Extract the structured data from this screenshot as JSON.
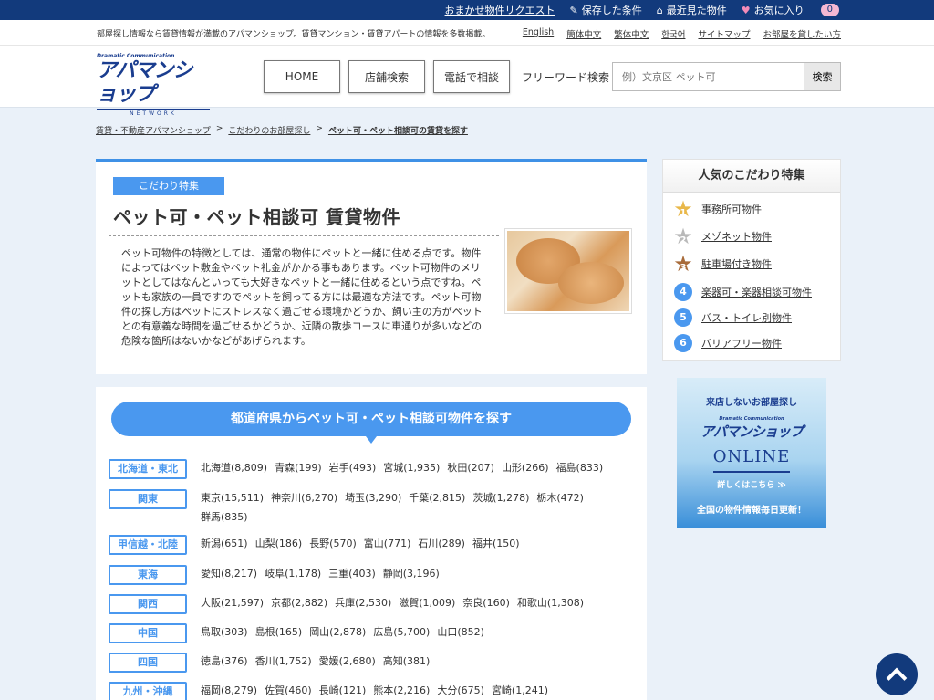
{
  "topbar": {
    "request": "おまかせ物件リクエスト",
    "saved": "保存した条件",
    "recent": "最近見た物件",
    "favorites": "お気に入り",
    "fav_count": "0"
  },
  "header": {
    "tagline": "部屋探し情報なら賃貸情報が満載のアパマンショップ。賃貸マンション・賃貸アパートの情報を多数掲載。",
    "langs": [
      "English",
      "簡体中文",
      "繁体中文",
      "한국어",
      "サイトマップ",
      "お部屋を貸したい方"
    ],
    "logo_small": "Dramatic Communication",
    "logo_main": "アパマンショップ",
    "logo_net": "NETWORK",
    "nav": [
      "HOME",
      "店舗検索",
      "電話で相談"
    ],
    "freeword_label": "フリーワード検索",
    "search_placeholder": "例）文京区 ペット可",
    "search_button": "検索"
  },
  "breadcrumb": [
    "賃貸・不動産アパマンショップ",
    "こだわりのお部屋探し",
    "ペット可・ペット相談可の賃貸を探す"
  ],
  "intro": {
    "tag": "こだわり特集",
    "title": "ペット可・ペット相談可 賃貸物件",
    "text": "ペット可物件の特徴としては、通常の物件にペットと一緒に住める点です。物件によってはペット敷金やペット礼金がかかる事もあります。ペット可物件のメリットとしてはなんといっても大好きなペットと一緒に住めるという点ですね。ペットも家族の一員ですのでペットを飼ってる方には最適な方法です。ペット可物件の探し方はペットにストレスなく過ごせる環境かどうか、飼い主の方がペットとの有意義な時間を過ごせるかどうか、近隣の散歩コースに車通りが多いなどの危険な箇所はないかなどがあげられます。"
  },
  "pref": {
    "heading": "都道府県からペット可・ペット相談可物件を探す",
    "regions": [
      {
        "name": "北海道・東北",
        "items": [
          "北海道(8,809)",
          "青森(199)",
          "岩手(493)",
          "宮城(1,935)",
          "秋田(207)",
          "山形(266)",
          "福島(833)"
        ]
      },
      {
        "name": "関東",
        "items": [
          "東京(15,511)",
          "神奈川(6,270)",
          "埼玉(3,290)",
          "千葉(2,815)",
          "茨城(1,278)",
          "栃木(472)",
          "群馬(835)"
        ]
      },
      {
        "name": "甲信越・北陸",
        "items": [
          "新潟(651)",
          "山梨(186)",
          "長野(570)",
          "富山(771)",
          "石川(289)",
          "福井(150)"
        ]
      },
      {
        "name": "東海",
        "items": [
          "愛知(8,217)",
          "岐阜(1,178)",
          "三重(403)",
          "静岡(3,196)"
        ]
      },
      {
        "name": "関西",
        "items": [
          "大阪(21,597)",
          "京都(2,882)",
          "兵庫(2,530)",
          "滋賀(1,009)",
          "奈良(160)",
          "和歌山(1,308)"
        ]
      },
      {
        "name": "中国",
        "items": [
          "鳥取(303)",
          "島根(165)",
          "岡山(2,878)",
          "広島(5,700)",
          "山口(852)"
        ]
      },
      {
        "name": "四国",
        "items": [
          "徳島(376)",
          "香川(1,752)",
          "愛媛(2,680)",
          "高知(381)"
        ]
      },
      {
        "name": "九州・沖縄",
        "items": [
          "福岡(8,279)",
          "佐賀(460)",
          "長崎(121)",
          "熊本(2,216)",
          "大分(675)",
          "宮崎(1,241)"
        ]
      }
    ]
  },
  "sidebar": {
    "heading": "人気のこだわり特集",
    "ranks": [
      {
        "n": "1",
        "label": "事務所可物件",
        "color": "#e9b84a"
      },
      {
        "n": "2",
        "label": "メゾネット物件",
        "color": "#b9b9b9"
      },
      {
        "n": "3",
        "label": "駐車場付き物件",
        "color": "#a86b3a"
      },
      {
        "n": "4",
        "label": "楽器可・楽器相談可物件",
        "color": "#4a98ef"
      },
      {
        "n": "5",
        "label": "バス・トイレ別物件",
        "color": "#4a98ef"
      },
      {
        "n": "6",
        "label": "バリアフリー物件",
        "color": "#4a98ef"
      }
    ]
  },
  "banner": {
    "title": "来店しないお部屋探し",
    "logo_small": "Dramatic Communication",
    "logo": "アパマンショップ",
    "online": "ONLINE",
    "detail": "詳しくはこちら ≫",
    "foot": "全国の物件情報毎日更新！"
  }
}
